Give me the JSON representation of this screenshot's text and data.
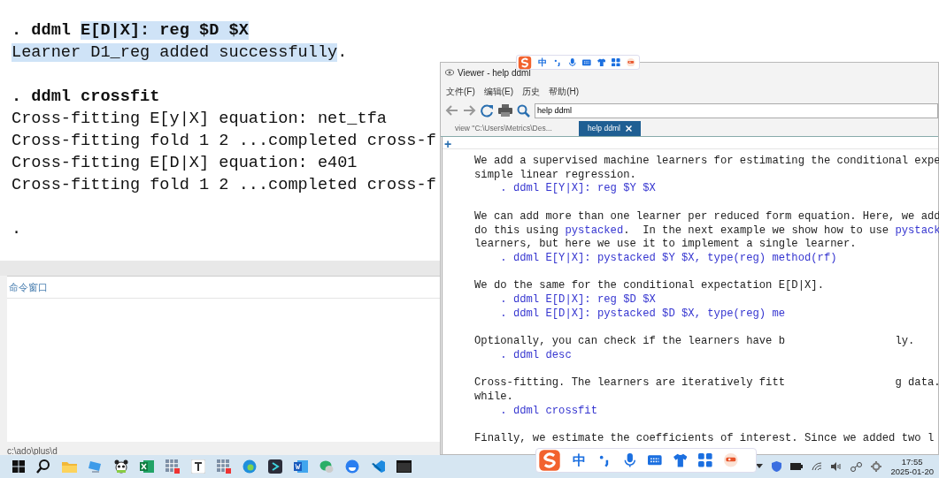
{
  "results": [
    {
      "lines": [
        {
          "kind": "command",
          "parts": [
            {
              "text": ". ddml ",
              "selected": false
            },
            {
              "text": "E[D|X]: reg $D $X",
              "selected": true
            }
          ]
        },
        {
          "kind": "output",
          "parts": [
            {
              "text": "Learner D1_reg added successfully",
              "selected": true
            },
            {
              "text": ".",
              "selected": false
            }
          ]
        }
      ]
    },
    {
      "lines": [
        {
          "kind": "command",
          "parts": [
            {
              "text": ". ddml crossfit",
              "selected": false
            }
          ]
        },
        {
          "kind": "output",
          "parts": [
            {
              "text": "Cross-fitting E[y|X] equation: net_tfa",
              "selected": false
            }
          ]
        },
        {
          "kind": "output",
          "parts": [
            {
              "text": "Cross-fitting fold 1 2 ...completed cross-f",
              "selected": false
            }
          ]
        },
        {
          "kind": "output",
          "parts": [
            {
              "text": "Cross-fitting E[D|X] equation: e401",
              "selected": false
            }
          ]
        },
        {
          "kind": "output",
          "parts": [
            {
              "text": "Cross-fitting fold 1 2 ...completed cross-f",
              "selected": false
            }
          ]
        }
      ]
    },
    {
      "lines": [
        {
          "kind": "output",
          "parts": [
            {
              "text": ".",
              "selected": false
            }
          ]
        }
      ]
    }
  ],
  "command_window": {
    "title": "命令窗口"
  },
  "status_bar": {
    "path": "c:\\ado\\plus\\d"
  },
  "viewer": {
    "title": "Viewer - help ddml",
    "menu": [
      "文件(F)",
      "编辑(E)",
      "历史",
      "帮助(H)"
    ],
    "search": {
      "value": "help ddml"
    },
    "tabs": [
      {
        "label": "view \"C:\\Users\\Metrics\\Des...",
        "selected": false
      },
      {
        "label": "help ddml",
        "selected": true
      }
    ],
    "new_tab": "+",
    "paragraphs": [
      {
        "lines": [
          {
            "kind": "text",
            "parts": [
              {
                "text": "We add a supervised machine learners for estimating the conditional expe",
                "link": false
              }
            ]
          },
          {
            "kind": "text",
            "parts": [
              {
                "text": "simple linear regression.",
                "link": false
              }
            ]
          },
          {
            "kind": "command",
            "text": ". ddml E[Y|X]: reg $Y $X"
          }
        ]
      },
      {
        "lines": [
          {
            "kind": "text",
            "parts": [
              {
                "text": "We can add more than one learner per reduced form equation. Here, we add",
                "link": false
              }
            ]
          },
          {
            "kind": "text",
            "parts": [
              {
                "text": "do this using ",
                "link": false
              },
              {
                "text": "pystacked",
                "link": true
              },
              {
                "text": ".  In the next example we show how to use ",
                "link": false
              },
              {
                "text": "pystack",
                "link": true
              }
            ]
          },
          {
            "kind": "text",
            "parts": [
              {
                "text": "learners, but here we use it to implement a single learner.",
                "link": false
              }
            ]
          },
          {
            "kind": "command",
            "text": ". ddml E[Y|X]: pystacked $Y $X, type(reg) method(rf)"
          }
        ]
      },
      {
        "lines": [
          {
            "kind": "text",
            "parts": [
              {
                "text": "We do the same for the conditional expectation E[D|X].",
                "link": false
              }
            ]
          },
          {
            "kind": "command",
            "text": ". ddml E[D|X]: reg $D $X"
          },
          {
            "kind": "command",
            "text": ". ddml E[D|X]: pystacked $D $X, type(reg) me"
          }
        ]
      },
      {
        "lines": [
          {
            "kind": "text",
            "parts": [
              {
                "text": "Optionally, you can check if the learners have b",
                "link": false
              }
            ],
            "resumes": "ly."
          },
          {
            "kind": "command",
            "text": ". ddml desc"
          }
        ]
      },
      {
        "lines": [
          {
            "kind": "text",
            "parts": [
              {
                "text": "Cross-fitting. The learners are iteratively fitt",
                "link": false
              }
            ],
            "resumes": "g data."
          },
          {
            "kind": "text",
            "parts": [
              {
                "text": "while.",
                "link": false
              }
            ]
          },
          {
            "kind": "command",
            "text": ". ddml crossfit"
          }
        ]
      },
      {
        "lines": [
          {
            "kind": "text",
            "parts": [
              {
                "text": "Finally, we estimate the coefficients of interest. Since we added two l",
                "link": false
              }
            ]
          }
        ]
      }
    ]
  },
  "ime_bars": [
    {
      "mode": "中"
    },
    {
      "mode": "中"
    }
  ],
  "clock": {
    "time": "17:55",
    "date": "2025-01-20"
  }
}
